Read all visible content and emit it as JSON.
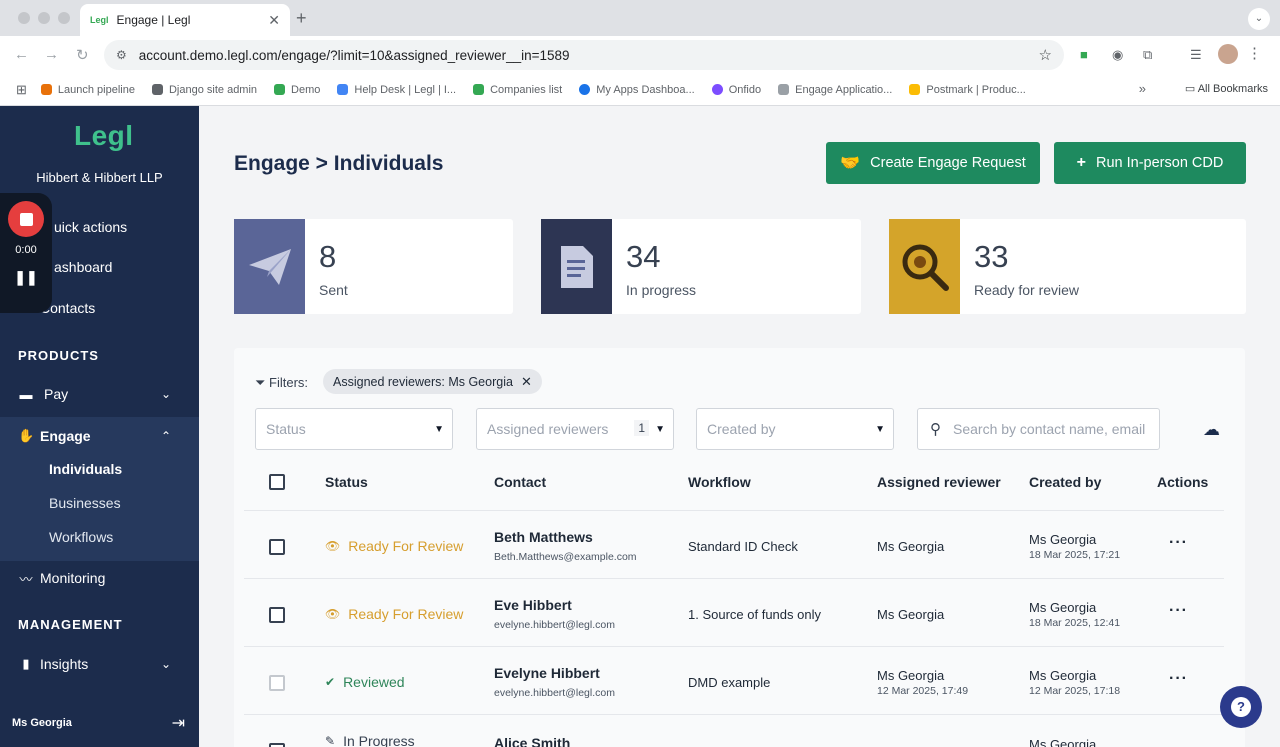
{
  "browser": {
    "tab_title": "Engage | Legl",
    "tab_favicon_text": "Legl",
    "url": "account.demo.legl.com/engage/?limit=10&assigned_reviewer__in=1589",
    "bookmarks": [
      {
        "label": "Launch pipeline",
        "color": "#e8710a"
      },
      {
        "label": "Django site admin",
        "color": "#5f6368"
      },
      {
        "label": "Demo",
        "color": "#34a853"
      },
      {
        "label": "Help Desk | Legl | I...",
        "color": "#4285f4"
      },
      {
        "label": "Companies list",
        "color": "#34a853"
      },
      {
        "label": "My Apps Dashboa...",
        "color": "#1a73e8"
      },
      {
        "label": "Onfido",
        "color": "#7c4dff"
      },
      {
        "label": "Engage Applicatio...",
        "color": "#9aa0a6"
      },
      {
        "label": "Postmark | Produc...",
        "color": "#fbbc04"
      }
    ],
    "all_bookmarks": "All Bookmarks"
  },
  "sidebar": {
    "logo": "Legl",
    "company": "Hibbert & Hibbert LLP",
    "quick_actions": "uick actions",
    "dashboard": "ashboard",
    "contacts": "Contacts",
    "products_title": "PRODUCTS",
    "pay": "Pay",
    "engage": "Engage",
    "engage_sub": [
      "Individuals",
      "Businesses",
      "Workflows"
    ],
    "monitoring": "Monitoring",
    "management_title": "MANAGEMENT",
    "insights": "Insights",
    "user": "Ms Georgia"
  },
  "recorder": {
    "time": "0:00"
  },
  "header": {
    "title": "Engage > Individuals",
    "create_button": "Create Engage Request",
    "cdd_button": "Run In-person CDD"
  },
  "stats": [
    {
      "value": "8",
      "label": "Sent",
      "color": "#5a6597"
    },
    {
      "value": "34",
      "label": "In progress",
      "color": "#2d3553"
    },
    {
      "value": "33",
      "label": "Ready for review",
      "color": "#d4a42a"
    }
  ],
  "filters": {
    "label": "Filters:",
    "chip": "Assigned reviewers: Ms Georgia",
    "status_placeholder": "Status",
    "reviewers_placeholder": "Assigned reviewers",
    "reviewers_count": "1",
    "created_by_placeholder": "Created by",
    "search_placeholder": "Search by contact name, email"
  },
  "table": {
    "headers": {
      "status": "Status",
      "contact": "Contact",
      "workflow": "Workflow",
      "reviewer": "Assigned reviewer",
      "created_by": "Created by",
      "actions": "Actions"
    },
    "rows": [
      {
        "status": "Ready For Review",
        "name": "Beth Matthews",
        "email": "Beth.Matthews@example.com",
        "workflow": "Standard ID Check",
        "reviewer": "Ms Georgia",
        "reviewer_date": "",
        "created_by": "Ms Georgia",
        "created_date": "18 Mar 2025, 17:21"
      },
      {
        "status": "Ready For Review",
        "name": "Eve Hibbert",
        "email": "evelyne.hibbert@legl.com",
        "workflow": "1. Source of funds only",
        "reviewer": "Ms Georgia",
        "reviewer_date": "",
        "created_by": "Ms Georgia",
        "created_date": "18 Mar 2025, 12:41"
      },
      {
        "status": "Reviewed",
        "name": "Evelyne Hibbert",
        "email": "evelyne.hibbert@legl.com",
        "workflow": "DMD example",
        "reviewer": "Ms Georgia",
        "reviewer_date": "12 Mar 2025, 17:49",
        "created_by": "Ms Georgia",
        "created_date": "12 Mar 2025, 17:18"
      },
      {
        "status": "In Progress",
        "name": "Alice Smith",
        "email": "",
        "workflow": "",
        "reviewer": "",
        "reviewer_date": "",
        "created_by": "Ms Georgia",
        "created_date": ""
      }
    ]
  },
  "help": {
    "label": "?"
  }
}
